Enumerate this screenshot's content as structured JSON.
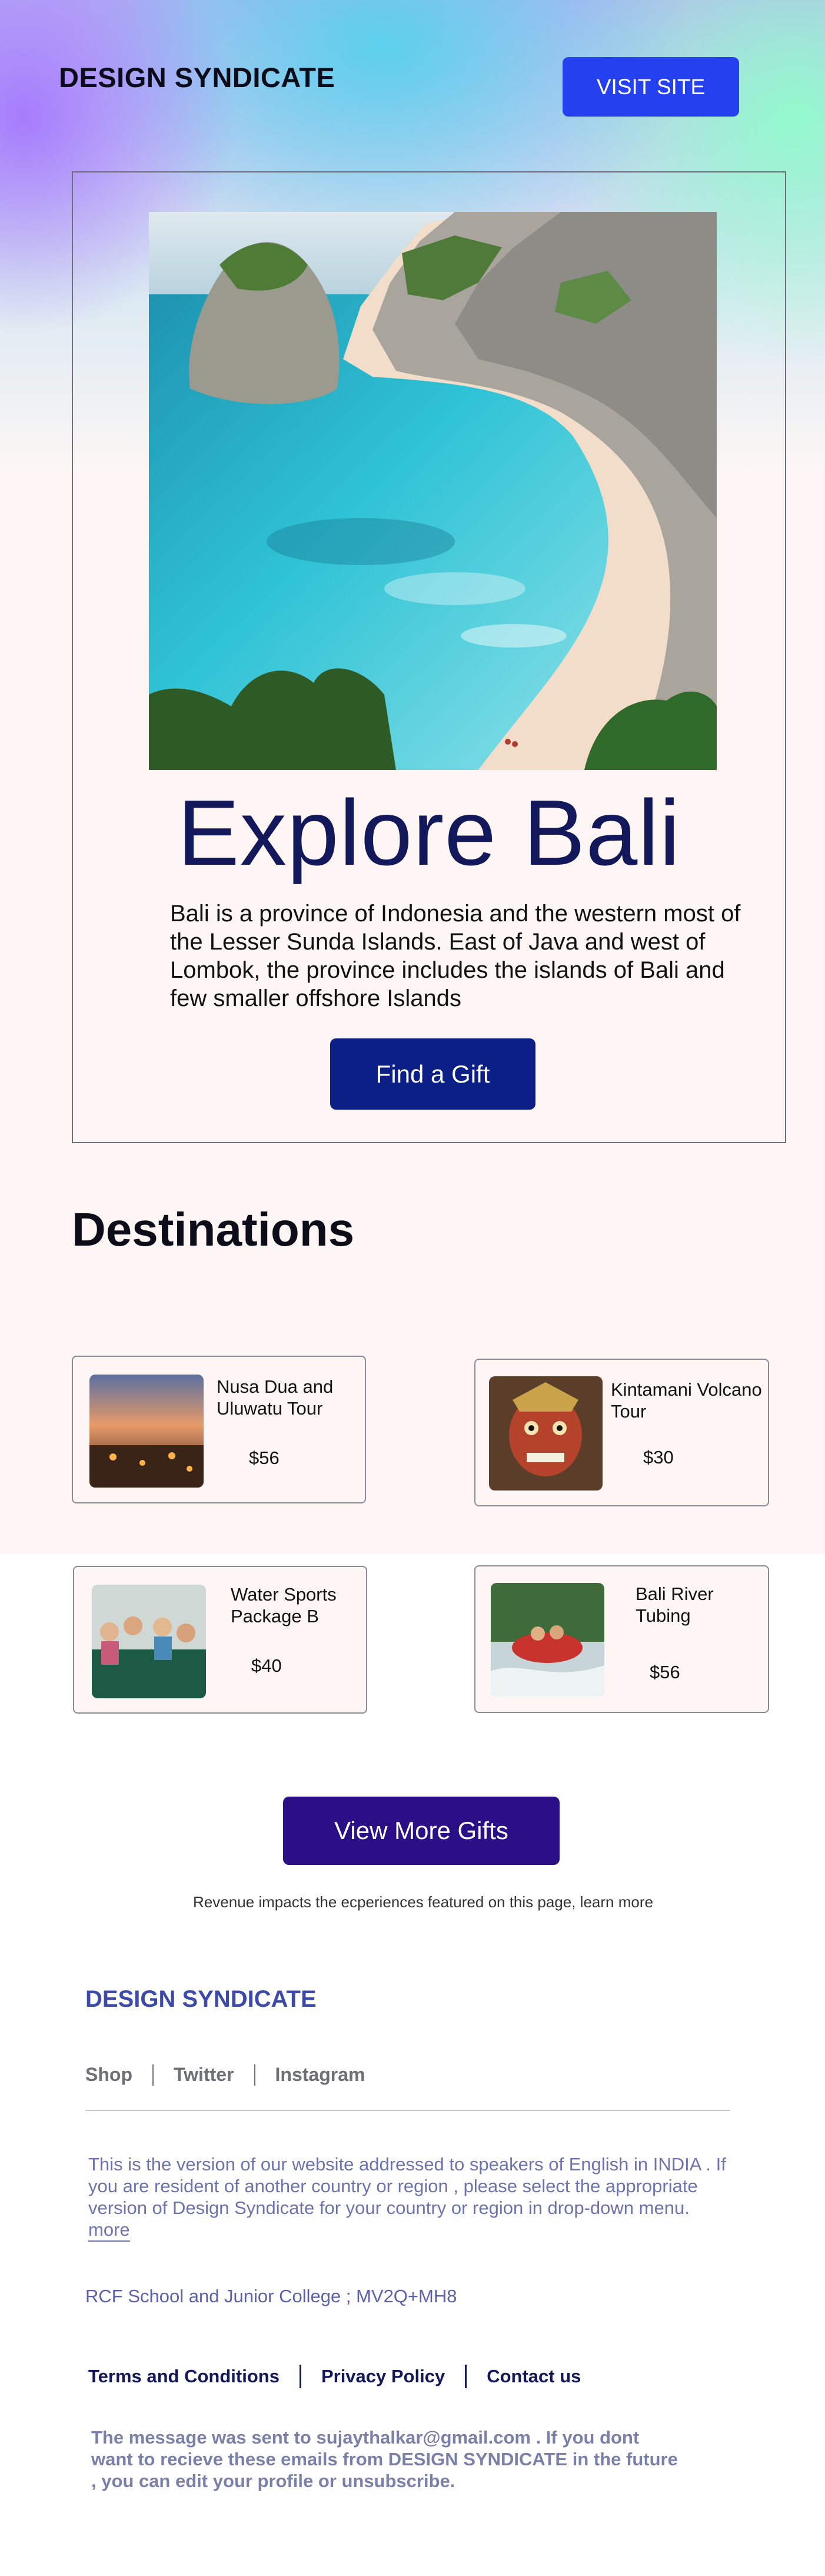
{
  "header": {
    "brand": "DESIGN SYNDICATE",
    "visit_label": "VISIT SITE"
  },
  "hero": {
    "title": "Explore Bali",
    "description": "Bali is a province of Indonesia and the western most of the Lesser Sunda Islands. East of Java and west of Lombok, the province includes the islands of Bali and few smaller offshore Islands",
    "gift_label": "Find a  Gift"
  },
  "destinations": {
    "heading": "Destinations",
    "items": [
      {
        "name": "Nusa Dua and Uluwatu Tour",
        "price": "$56"
      },
      {
        "name": "Kintamani Volcano Tour",
        "price": "$30"
      },
      {
        "name": "Water Sports Package B",
        "price": "$40"
      },
      {
        "name": "Bali River Tubing",
        "price": "$56"
      }
    ]
  },
  "cta": {
    "more_label": "View More Gifts",
    "revenue_note": "Revenue impacts the ecperiences featured on this page, learn more"
  },
  "footer": {
    "brand": "DESIGN SYNDICATE",
    "links": [
      "Shop",
      "Twitter",
      "Instagram"
    ],
    "notice": "This is the version of our website addressed to speakers of English in INDIA .  If you are resident of another country or region , please select the appropriate version of Design Syndicate for your country or region in drop-down menu.",
    "more_label": "more",
    "address": "RCF School and Junior College ; MV2Q+MH8",
    "legal": [
      "Terms and Conditions",
      "Privacy Policy",
      "Contact us"
    ],
    "unsubscribe": "The message was sent to sujaythalkar@gmail.com . If you dont want to recieve these emails from DESIGN SYNDICATE in the future , you can edit your profile or unsubscribe."
  },
  "colors": {
    "visit_button": "#2540ee",
    "gift_button": "#0b1f86",
    "more_button": "#2a0f86",
    "title": "#13185a",
    "footer_brand": "#3e4aa8"
  }
}
